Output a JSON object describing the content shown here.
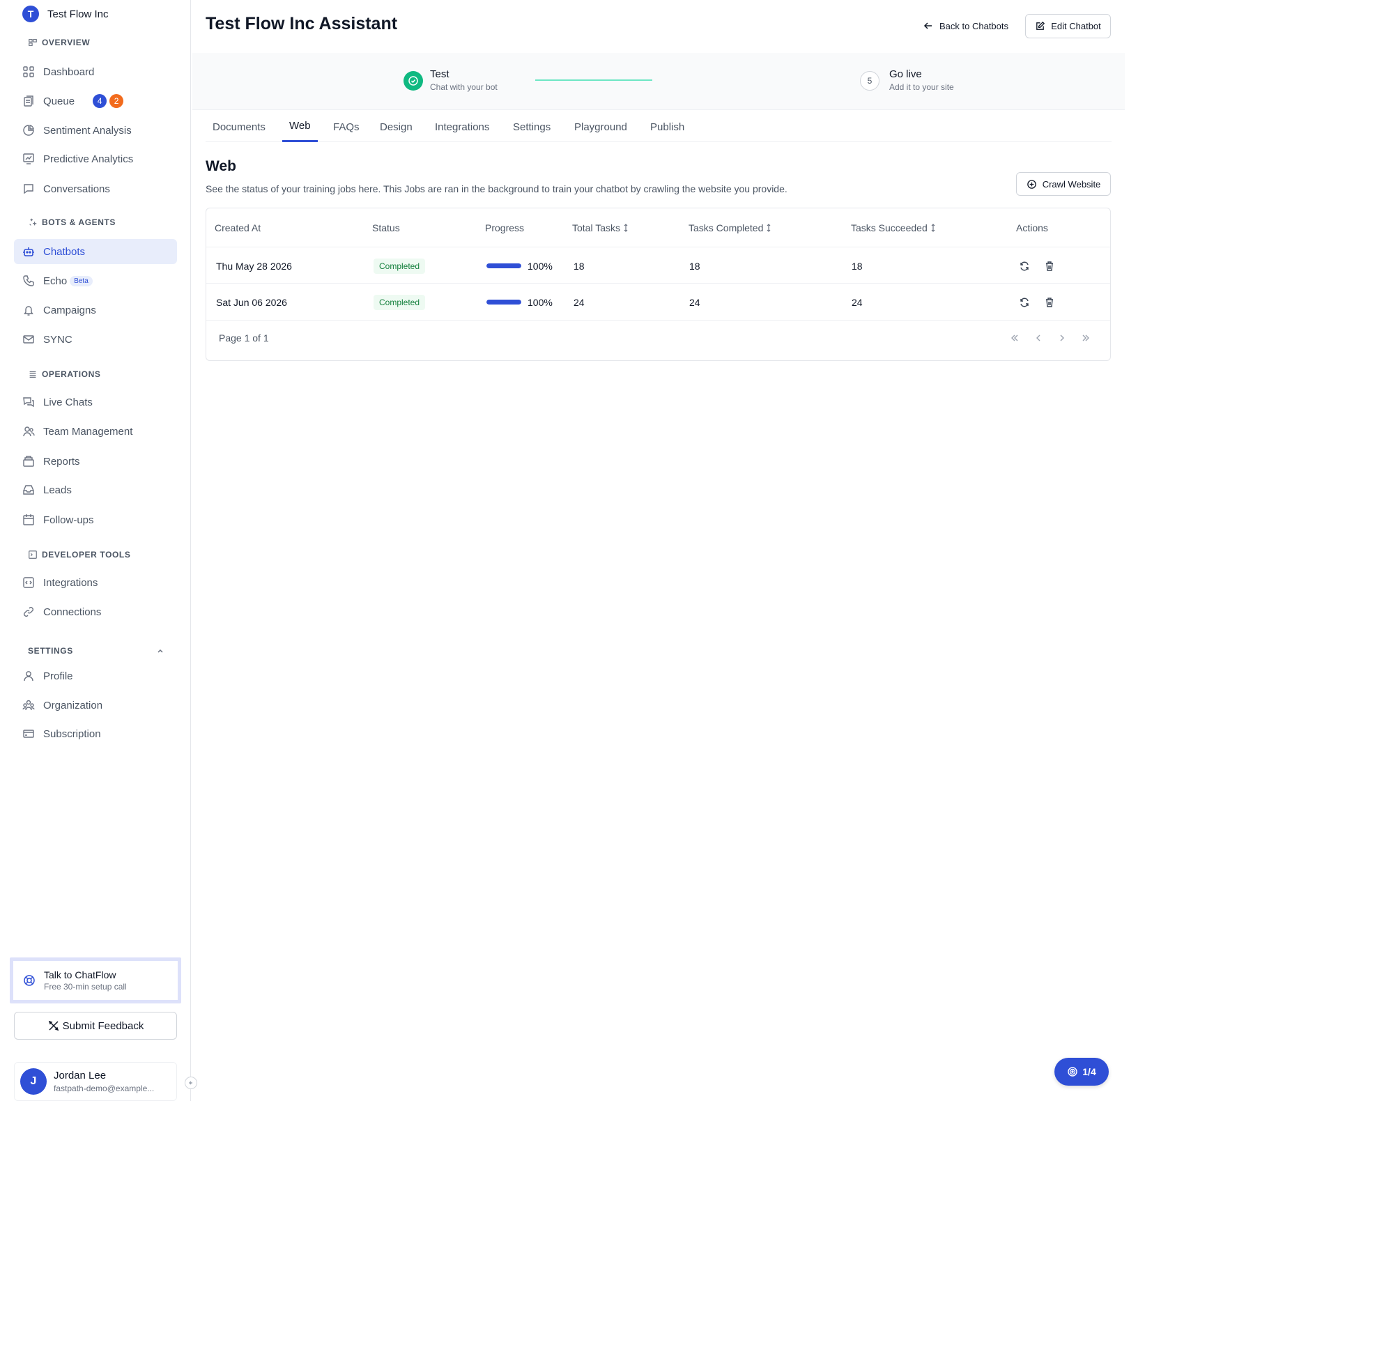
{
  "sidebar": {
    "org_initial": "T",
    "org_name": "Test Flow Inc",
    "sections": {
      "overview": "OVERVIEW",
      "bots": "BOTS & AGENTS",
      "operations": "OPERATIONS",
      "developer": "DEVELOPER TOOLS",
      "settings": "SETTINGS"
    },
    "items": {
      "dashboard": "Dashboard",
      "queue": "Queue",
      "queue_badge_blue": "4",
      "queue_badge_orange": "2",
      "sentiment": "Sentiment Analysis",
      "predictive": "Predictive Analytics",
      "conversations": "Conversations",
      "chatbots": "Chatbots",
      "echo": "Echo",
      "echo_badge": "Beta",
      "campaigns": "Campaigns",
      "sync": "SYNC",
      "live_chats": "Live Chats",
      "team": "Team Management",
      "reports": "Reports",
      "leads": "Leads",
      "followups": "Follow-ups",
      "integrations": "Integrations",
      "connections": "Connections",
      "profile": "Profile",
      "organization": "Organization",
      "subscription": "Subscription"
    },
    "talk_title": "Talk to ChatFlow",
    "talk_subtitle": "Free 30-min setup call",
    "feedback_label": "Submit Feedback",
    "user_initial": "J",
    "user_name": "Jordan Lee",
    "user_email": "fastpath-demo@example..."
  },
  "header": {
    "title": "Test Flow Inc Assistant",
    "back_label": "Back to Chatbots",
    "edit_label": "Edit Chatbot"
  },
  "stepper": {
    "step_test_title": "Test",
    "step_test_sub": "Chat with your bot",
    "step_live_num": "5",
    "step_live_title": "Go live",
    "step_live_sub": "Add it to your site"
  },
  "tabs": [
    "Documents",
    "Web",
    "FAQs",
    "Design",
    "Integrations",
    "Settings",
    "Playground",
    "Publish"
  ],
  "web": {
    "title": "Web",
    "description": "See the status of your training jobs here. This Jobs are ran in the background to train your chatbot by crawling the website you provide.",
    "crawl_label": "Crawl Website"
  },
  "table": {
    "headers": {
      "created": "Created At",
      "status": "Status",
      "progress": "Progress",
      "total": "Total Tasks",
      "completed": "Tasks Completed",
      "succeeded": "Tasks Succeeded",
      "actions": "Actions"
    },
    "rows": [
      {
        "created": "Thu May 28 2026",
        "status": "Completed",
        "progress_pct": 100,
        "progress_label": "100%",
        "total": "18",
        "completed": "18",
        "succeeded": "18"
      },
      {
        "created": "Sat Jun 06 2026",
        "status": "Completed",
        "progress_pct": 100,
        "progress_label": "100%",
        "total": "24",
        "completed": "24",
        "succeeded": "24"
      }
    ],
    "pagination": "Page 1 of 1"
  },
  "floating": {
    "label": "1/4"
  },
  "colors": {
    "accent": "#2f4fd6",
    "success": "#10b981",
    "badge_orange": "#f26b1d"
  }
}
